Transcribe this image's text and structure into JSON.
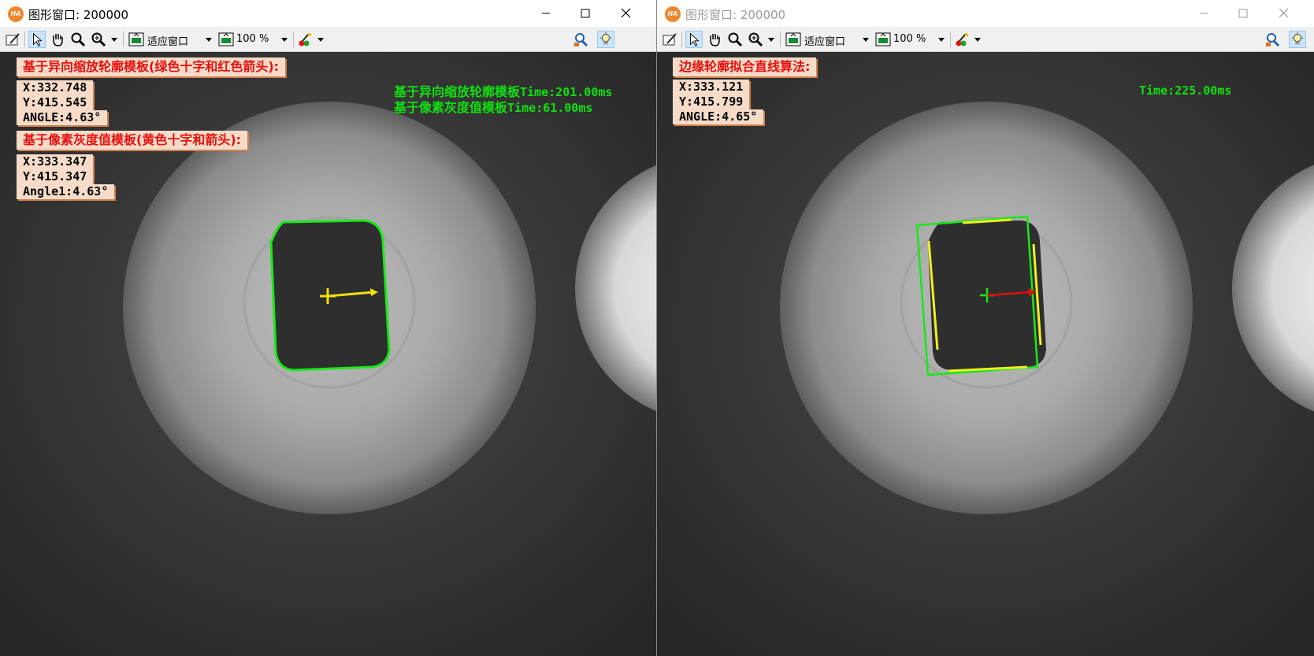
{
  "left_window": {
    "title": "图形窗口: 200000",
    "app_icon": "HA",
    "toolbar": {
      "fit_window_label": "适应窗口",
      "zoom_level": "100 %"
    },
    "overlay": {
      "shape_header": "基于异向缩放轮廓模板(绿色十字和红色箭头):",
      "shape_x": "X:332.748",
      "shape_y": "Y:415.545",
      "shape_angle": "ANGLE:4.63°",
      "gray_header": "基于像素灰度值模板(黄色十字和箭头):",
      "gray_x": "X:333.347",
      "gray_y": "Y:415.347",
      "gray_angle": "Angle1:4.63°",
      "timing_shape_label": "基于异向缩放轮廓模板",
      "timing_shape_value": "Time:201.00ms",
      "timing_gray_label": "基于像素灰度值模板",
      "timing_gray_value": "Time:61.00ms"
    }
  },
  "right_window": {
    "title": "图形窗口: 200000",
    "app_icon": "HA",
    "toolbar": {
      "fit_window_label": "适应窗口",
      "zoom_level": "100 %"
    },
    "overlay": {
      "header": "边缘轮廓拟合直线算法:",
      "x": "X:333.121",
      "y": "Y:415.799",
      "angle": "ANGLE:4.65°",
      "time": "Time:225.00ms"
    }
  },
  "colors": {
    "label_bg": "#f6dcc8",
    "label_red": "#e81010",
    "contour_green": "#10e010",
    "marker_yellow": "#f0e010",
    "arrow_red": "#e01010"
  }
}
